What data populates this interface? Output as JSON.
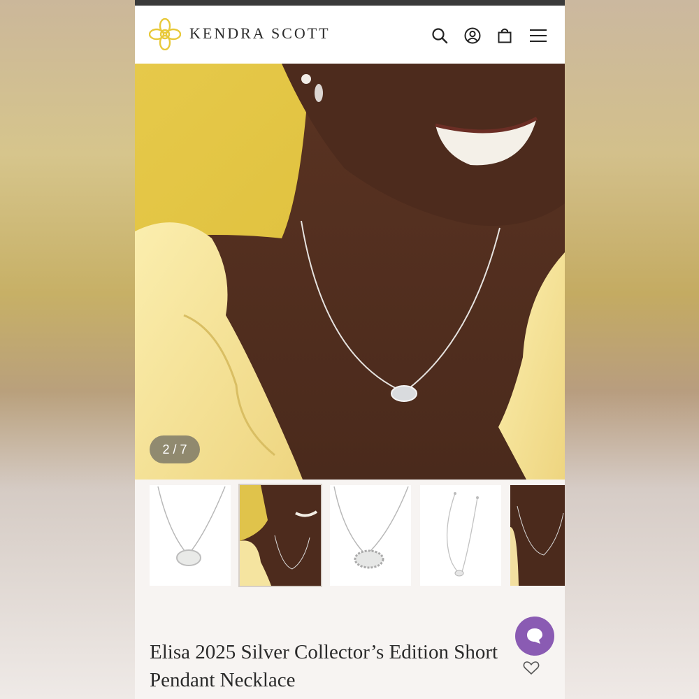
{
  "brand": {
    "name": "KENDRA SCOTT",
    "accent": "#e8c93a"
  },
  "header": {
    "icons": [
      "search-icon",
      "account-icon",
      "bag-icon",
      "menu-icon"
    ]
  },
  "gallery": {
    "counter": "2 / 7",
    "current": 2,
    "total": 7,
    "thumbnails": [
      "necklace-product-shot",
      "model-wearing-necklace",
      "necklace-closeup",
      "necklace-full-length",
      "model-wearing-necklace-partial"
    ]
  },
  "product": {
    "title": "Elisa 2025 Silver Collector’s Edition Short Pendant Necklace"
  },
  "chat": {
    "color": "#8a5bb3"
  }
}
